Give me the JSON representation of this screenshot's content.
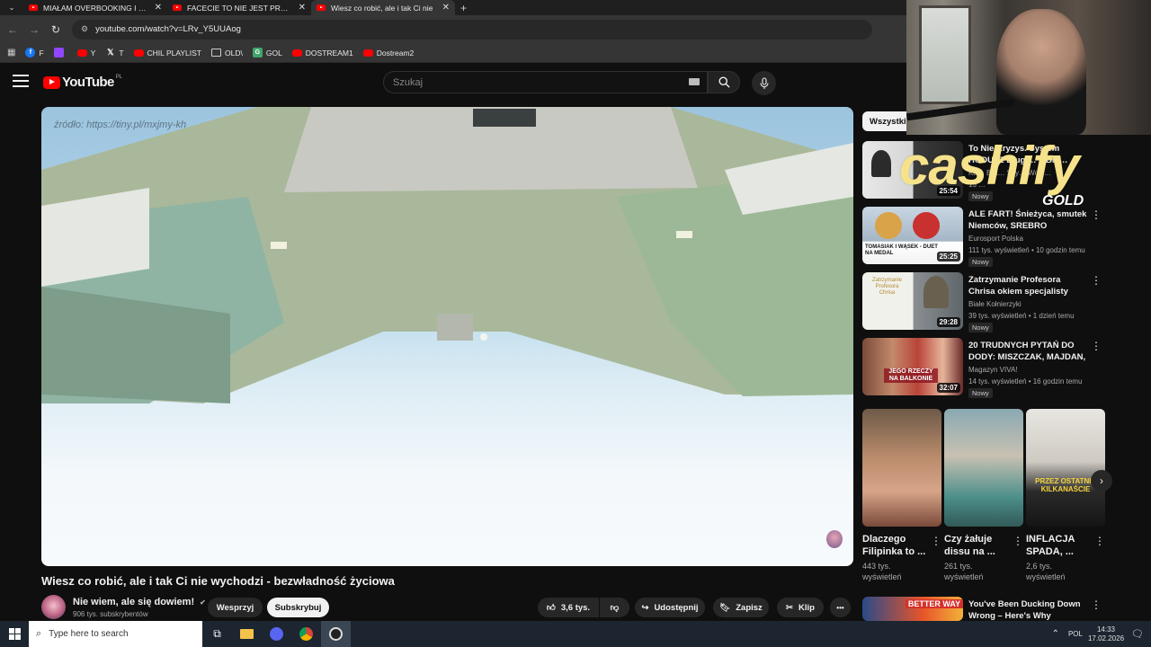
{
  "browser": {
    "tabs": [
      {
        "title": "MIAŁAM OVERBOOKING I NIE",
        "active": false
      },
      {
        "title": "FACECIE TO NIE JEST PRZYPADE",
        "active": false
      },
      {
        "title": "Wiesz co robić, ale i tak Ci nie",
        "active": true
      }
    ],
    "url": "youtube.com/watch?v=LRv_Y5UUAog",
    "bookmarks": [
      {
        "label": "F",
        "icon": "facebook-icon"
      },
      {
        "label": "",
        "icon": "twitch-icon"
      },
      {
        "label": "Y",
        "icon": "youtube-icon"
      },
      {
        "label": "T",
        "icon": "x-icon"
      },
      {
        "label": "CHIL PLAYLIST",
        "icon": "youtube-icon"
      },
      {
        "label": "OLD\\",
        "icon": "folder-icon"
      },
      {
        "label": "GOL",
        "icon": "gol-icon"
      },
      {
        "label": "DOSTREAM1",
        "icon": "youtube-icon"
      },
      {
        "label": "Dostream2",
        "icon": "youtube-icon"
      }
    ]
  },
  "youtube": {
    "logo_text": "YouTube",
    "logo_country": "PL",
    "search_placeholder": "Szukaj",
    "video": {
      "source_overlay": "źródło: https://tiny.pl/mxjmy-kh",
      "title": "Wiesz co robić, ale i tak Ci nie wychodzi - bezwładność życiowa",
      "channel_name": "Nie wiem, ale się dowiem!",
      "verified_icon": "✔",
      "subscribers": "906 tys. subskrybentów",
      "support_label": "Wesprzyj",
      "subscribe_label": "Subskrybuj",
      "likes": "3,6 tys.",
      "share_label": "Udostępnij",
      "save_label": "Zapisz",
      "clip_label": "Klip",
      "more_label": "•••"
    },
    "filter_chip": "Wszystkie",
    "recommendations": [
      {
        "title": "To Nie Kryzys. System HODUJE Długi… – Bie…",
        "channel": "Ka… Bra… Szy… Wojc…",
        "meta": "15 …",
        "duration": "25:54",
        "badge": "Nowy"
      },
      {
        "title": "ALE FART! Śnieżyca, smutek Niemców, SREBRO POLAKÓW!...",
        "channel": "Eurosport Polska",
        "meta": "111 tys. wyświetleń • 10 godzin temu",
        "duration": "25:25",
        "badge": "Nowy"
      },
      {
        "title": "Zatrzymanie Profesora Chrisa okiem specjalisty",
        "channel": "Białe Kołnierzyki",
        "meta": "39 tys. wyświetleń • 1 dzień temu",
        "duration": "29:28",
        "badge": "Nowy",
        "thumb_text": "Zatrzymanie Profesora Chrisa"
      },
      {
        "title": "20 TRUDNYCH PYTAŃ DO DODY: MISZCZAK, MAJDAN, ...",
        "channel": "Magazyn VIVA!",
        "meta": "14 tys. wyświetleń • 16 godzin temu",
        "duration": "32:07",
        "badge": "Nowy"
      }
    ],
    "recommendation_thumb_texts": {
      "second": "TOMASIAK I WĄSEK - DUET NA MEDAL",
      "fourth": "JEGO RZECZY NA BALKONIE"
    },
    "shorts": [
      {
        "title": "Dlaczego Filipinka to ...",
        "views": "443 tys. wyświetleń"
      },
      {
        "title": "Czy żałuje dissu na ...",
        "views": "261 tys. wyświetleń"
      },
      {
        "title": "INFLACJA SPADA, ...",
        "views": "2,6 tys. wyświetleń",
        "thumb_text": "PRZEZ OSTATNIE KILKANAŚCIE"
      }
    ],
    "next_rec": {
      "title": "You've Been Ducking Down Wrong – Here's Why",
      "thumb_text": "BETTER WAY"
    }
  },
  "overlay": {
    "sponsor": "cashify",
    "sponsor_sub": "GOLD"
  },
  "taskbar": {
    "search_placeholder": "Type here to search",
    "language": "POL",
    "time": "14:33",
    "date": "17.02.2026"
  },
  "colors": {
    "accent": "#ff0000",
    "background": "#0f0f0f",
    "sponsor_yellow": "#f6e28a"
  }
}
